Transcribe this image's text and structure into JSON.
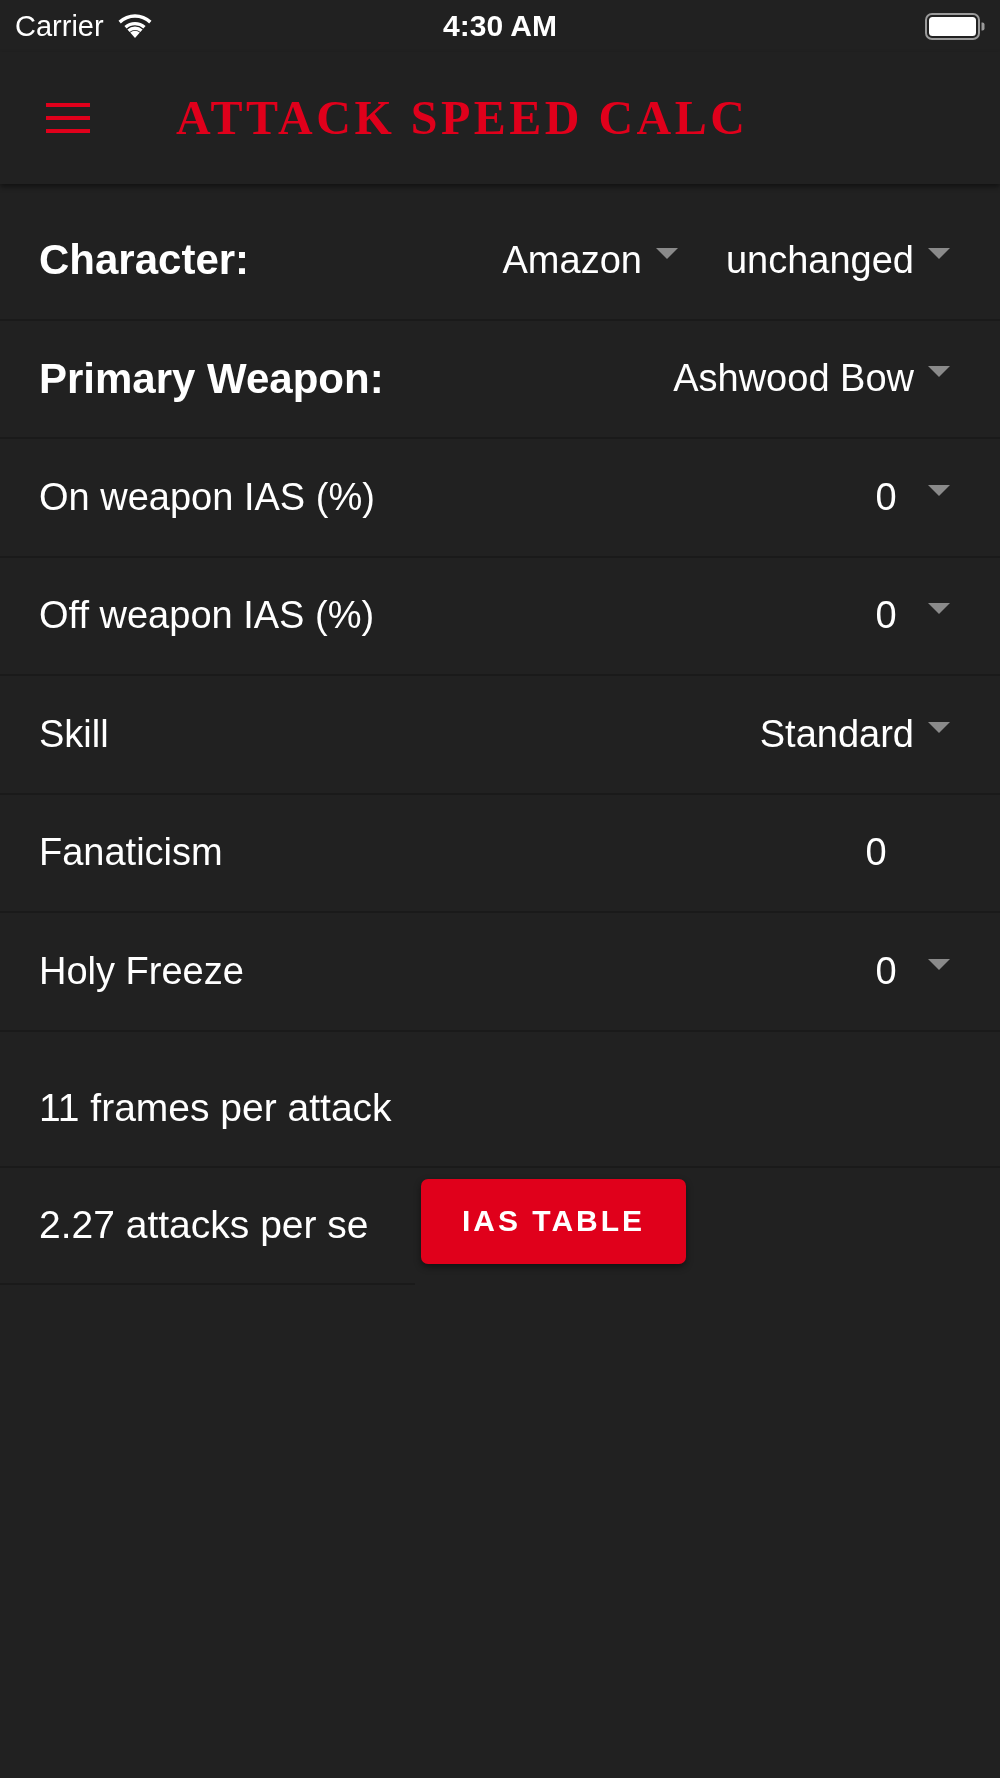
{
  "status_bar": {
    "carrier": "Carrier",
    "time": "4:30 AM"
  },
  "app_bar": {
    "title": "ATTACK SPEED CALC"
  },
  "settings": [
    {
      "label": "Character:",
      "bold": true,
      "fields": [
        {
          "kind": "select",
          "value": "Amazon"
        },
        {
          "kind": "select",
          "value": "unchanged"
        }
      ]
    },
    {
      "label": "Primary Weapon:",
      "bold": true,
      "fields": [
        {
          "kind": "select",
          "value": "Ashwood Bow"
        }
      ]
    },
    {
      "label": "On weapon IAS (%)",
      "bold": false,
      "fields": [
        {
          "kind": "number",
          "value": "0"
        }
      ]
    },
    {
      "label": "Off weapon IAS (%)",
      "bold": false,
      "fields": [
        {
          "kind": "number",
          "value": "0"
        }
      ]
    },
    {
      "label": "Skill",
      "bold": false,
      "fields": [
        {
          "kind": "select",
          "value": "Standard"
        }
      ]
    },
    {
      "label": "Fanaticism",
      "bold": false,
      "fields": [
        {
          "kind": "input",
          "value": "0"
        }
      ]
    },
    {
      "label": "Holy Freeze",
      "bold": false,
      "fields": [
        {
          "kind": "number",
          "value": "0"
        }
      ]
    }
  ],
  "results": [
    "11 frames per attack",
    "2.27 attacks per se"
  ],
  "ias_table_button": {
    "label": "IAS TABLE"
  }
}
